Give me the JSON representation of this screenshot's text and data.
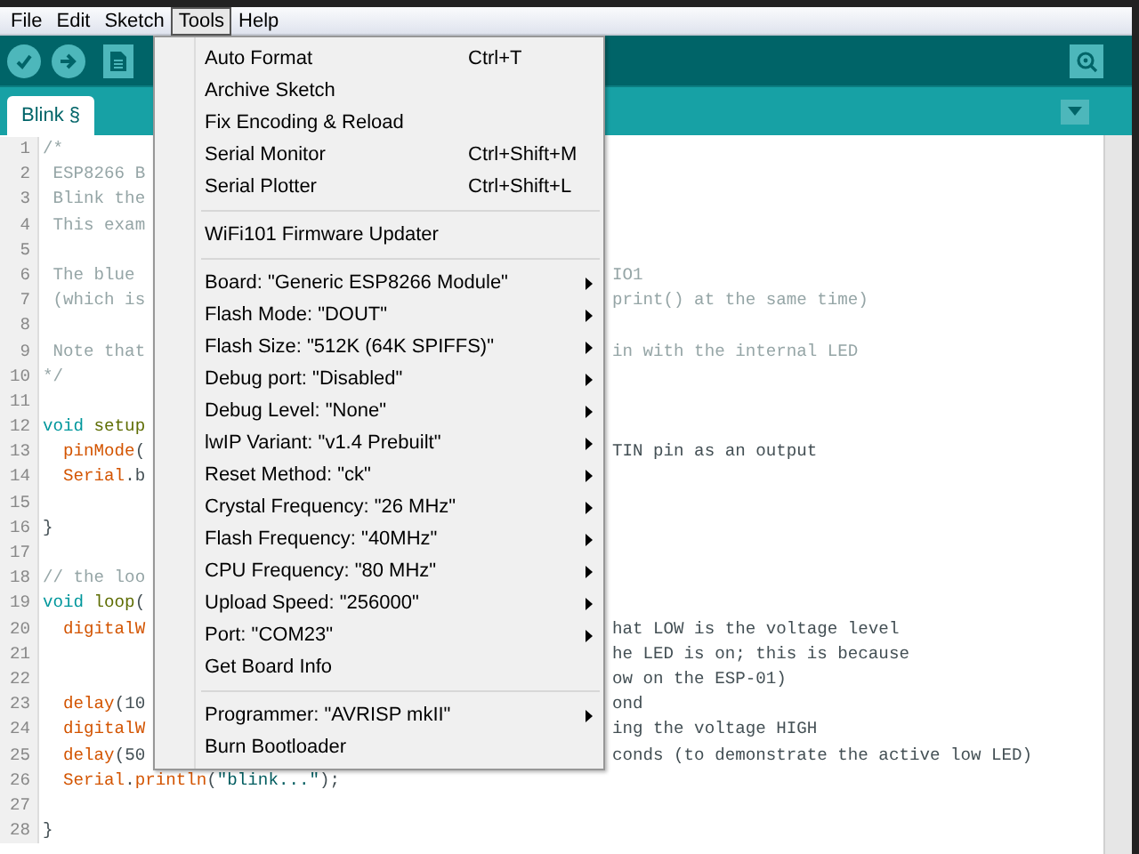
{
  "menubar": [
    {
      "label": "File",
      "selected": false
    },
    {
      "label": "Edit",
      "selected": false
    },
    {
      "label": "Sketch",
      "selected": false
    },
    {
      "label": "Tools",
      "selected": true
    },
    {
      "label": "Help",
      "selected": false
    }
  ],
  "tabs": [
    {
      "label": "Blink §",
      "selected": true
    }
  ],
  "code": [
    {
      "number": "1",
      "left": [
        {
          "text": "/*",
          "kind": "comment"
        }
      ]
    },
    {
      "number": "2",
      "left": [
        {
          "text": " ESP8266 B",
          "kind": "comment"
        }
      ]
    },
    {
      "number": "3",
      "left": [
        {
          "text": " Blink the",
          "kind": "comment"
        }
      ]
    },
    {
      "number": "4",
      "left": [
        {
          "text": " This exam",
          "kind": "comment"
        }
      ]
    },
    {
      "number": "5"
    },
    {
      "number": "6",
      "left": [
        {
          "text": " The blue ",
          "kind": "comment"
        }
      ],
      "right": {
        "text": "IO1",
        "kind": "comment"
      }
    },
    {
      "number": "7",
      "left": [
        {
          "text": " (which is",
          "kind": "comment"
        }
      ],
      "right": {
        "text": "print() at the same time)",
        "kind": "comment"
      }
    },
    {
      "number": "8"
    },
    {
      "number": "9",
      "left": [
        {
          "text": " Note that",
          "kind": "comment"
        }
      ],
      "right": {
        "text": "in with the internal LED",
        "kind": "comment"
      }
    },
    {
      "number": "10",
      "left": [
        {
          "text": "*/",
          "kind": "comment"
        }
      ]
    },
    {
      "number": "11"
    },
    {
      "number": "12",
      "left": [
        {
          "text": "void",
          "kind": "keyword"
        },
        {
          "text": " setup",
          "kind": "function"
        }
      ]
    },
    {
      "number": "13",
      "left": [
        {
          "text": "  pinMode",
          "kind": "call"
        },
        {
          "text": "(",
          "kind": "plain"
        }
      ],
      "right": {
        "text": "TIN pin as an output",
        "kind": "plain"
      }
    },
    {
      "number": "14",
      "left": [
        {
          "text": "  Serial",
          "kind": "call"
        },
        {
          "text": ".b",
          "kind": "plain"
        }
      ]
    },
    {
      "number": "15"
    },
    {
      "number": "16",
      "left": [
        {
          "text": "}",
          "kind": "plain"
        }
      ]
    },
    {
      "number": "17"
    },
    {
      "number": "18",
      "left": [
        {
          "text": "// the loo",
          "kind": "comment"
        }
      ]
    },
    {
      "number": "19",
      "left": [
        {
          "text": "void",
          "kind": "keyword"
        },
        {
          "text": " loop",
          "kind": "function"
        },
        {
          "text": "(",
          "kind": "plain"
        }
      ]
    },
    {
      "number": "20",
      "left": [
        {
          "text": "  digitalW",
          "kind": "call"
        }
      ],
      "right": {
        "text": "hat LOW is the voltage level",
        "kind": "plain"
      }
    },
    {
      "number": "21",
      "right": {
        "text": "he LED is on; this is because",
        "kind": "plain"
      }
    },
    {
      "number": "22",
      "right": {
        "text": "ow on the ESP-01)",
        "kind": "plain"
      }
    },
    {
      "number": "23",
      "left": [
        {
          "text": "  delay",
          "kind": "call"
        },
        {
          "text": "(10",
          "kind": "plain"
        }
      ],
      "right": {
        "text": "ond",
        "kind": "plain"
      }
    },
    {
      "number": "24",
      "left": [
        {
          "text": "  digitalW",
          "kind": "call"
        }
      ],
      "right": {
        "text": "ing the voltage HIGH",
        "kind": "plain"
      }
    },
    {
      "number": "25",
      "left": [
        {
          "text": "  delay",
          "kind": "call"
        },
        {
          "text": "(50",
          "kind": "plain"
        }
      ],
      "right": {
        "text": "conds (to demonstrate the active low LED)",
        "kind": "plain"
      }
    },
    {
      "number": "26",
      "left": [
        {
          "text": "  Serial",
          "kind": "call"
        },
        {
          "text": ".",
          "kind": "plain"
        },
        {
          "text": "println",
          "kind": "call"
        },
        {
          "text": "(",
          "kind": "plain"
        },
        {
          "text": "\"blink...\"",
          "kind": "string"
        },
        {
          "text": ");",
          "kind": "plain"
        }
      ]
    },
    {
      "number": "27"
    },
    {
      "number": "28",
      "left": [
        {
          "text": "}",
          "kind": "plain"
        }
      ]
    }
  ],
  "tools_menu": [
    {
      "kind": "item",
      "label": "Auto Format",
      "shortcut": "Ctrl+T"
    },
    {
      "kind": "item",
      "label": "Archive Sketch"
    },
    {
      "kind": "item",
      "label": "Fix Encoding & Reload"
    },
    {
      "kind": "item",
      "label": "Serial Monitor",
      "shortcut": "Ctrl+Shift+M"
    },
    {
      "kind": "item",
      "label": "Serial Plotter",
      "shortcut": "Ctrl+Shift+L"
    },
    {
      "kind": "separator"
    },
    {
      "kind": "item",
      "label": "WiFi101 Firmware Updater"
    },
    {
      "kind": "separator"
    },
    {
      "kind": "submenu",
      "label": "Board: \"Generic ESP8266 Module\""
    },
    {
      "kind": "submenu",
      "label": "Flash Mode: \"DOUT\""
    },
    {
      "kind": "submenu",
      "label": "Flash Size: \"512K (64K SPIFFS)\""
    },
    {
      "kind": "submenu",
      "label": "Debug port: \"Disabled\""
    },
    {
      "kind": "submenu",
      "label": "Debug Level: \"None\""
    },
    {
      "kind": "submenu",
      "label": "lwIP Variant: \"v1.4 Prebuilt\""
    },
    {
      "kind": "submenu",
      "label": "Reset Method: \"ck\""
    },
    {
      "kind": "submenu",
      "label": "Crystal Frequency: \"26 MHz\""
    },
    {
      "kind": "submenu",
      "label": "Flash Frequency: \"40MHz\""
    },
    {
      "kind": "submenu",
      "label": "CPU Frequency: \"80 MHz\""
    },
    {
      "kind": "submenu",
      "label": "Upload Speed: \"256000\""
    },
    {
      "kind": "submenu",
      "label": "Port: \"COM23\""
    },
    {
      "kind": "item",
      "label": "Get Board Info"
    },
    {
      "kind": "separator"
    },
    {
      "kind": "submenu",
      "label": "Programmer: \"AVRISP mkII\""
    },
    {
      "kind": "item",
      "label": "Burn Bootloader"
    }
  ]
}
